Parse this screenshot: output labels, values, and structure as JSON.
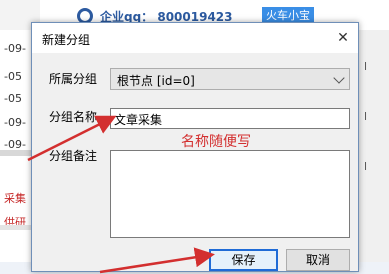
{
  "background": {
    "qq_label": "企业qq：  800019423",
    "badge_label": "火车小宝",
    "rows": [
      "-09-",
      "-05",
      "-05",
      "-09-",
      "-09-"
    ],
    "red_items": [
      "采集",
      "供研"
    ],
    "right_rows": [
      "l",
      "l",
      "l"
    ]
  },
  "dialog": {
    "title": "新建分组",
    "close_symbol": "✕",
    "parent_label": "所属分组",
    "parent_value": "根节点 [id=0]",
    "name_label": "分组名称",
    "name_value": "文章采集",
    "note_label": "分组备注",
    "note_value": "",
    "annotation": "名称随便写",
    "save_label": "保存",
    "cancel_label": "取消"
  },
  "colors": {
    "annotation": "#d32f2f",
    "arrow": "#d32f2f",
    "save_border": "#1f6bd6"
  }
}
